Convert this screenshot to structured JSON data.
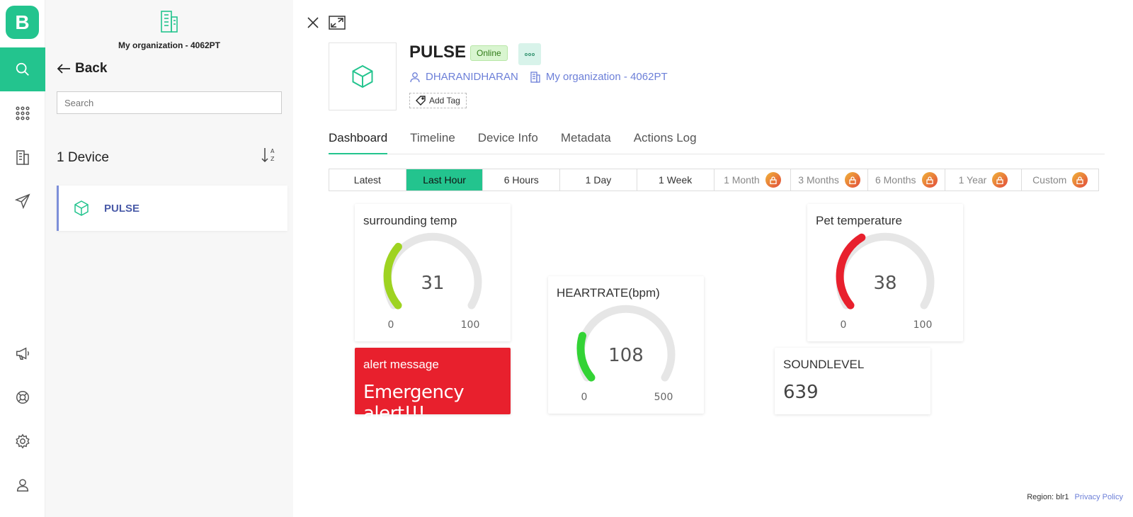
{
  "rail": {
    "logo": "B",
    "items": [
      "search-icon",
      "apps-icon",
      "building-icon",
      "send-icon",
      "megaphone-icon",
      "lifebuoy-icon",
      "gear-icon",
      "user-icon"
    ]
  },
  "sidebar": {
    "org_name": "My organization - 4062PT",
    "back_label": "Back",
    "search_placeholder": "Search",
    "device_count": "1 Device",
    "devices": [
      {
        "name": "PULSE"
      }
    ]
  },
  "device": {
    "name": "PULSE",
    "status": "Online",
    "owner": "DHARANIDHARAN",
    "organization": "My organization - 4062PT",
    "add_tag": "Add Tag"
  },
  "tabs": [
    "Dashboard",
    "Timeline",
    "Device Info",
    "Metadata",
    "Actions Log"
  ],
  "active_tab": "Dashboard",
  "time_ranges": [
    {
      "label": "Latest",
      "locked": false
    },
    {
      "label": "Last Hour",
      "locked": false,
      "active": true
    },
    {
      "label": "6 Hours",
      "locked": false
    },
    {
      "label": "1 Day",
      "locked": false
    },
    {
      "label": "1 Week",
      "locked": false
    },
    {
      "label": "1 Month",
      "locked": true
    },
    {
      "label": "3 Months",
      "locked": true
    },
    {
      "label": "6 Months",
      "locked": true
    },
    {
      "label": "1 Year",
      "locked": true
    },
    {
      "label": "Custom",
      "locked": true
    }
  ],
  "widgets": {
    "surrounding_temp": {
      "title": "surrounding temp",
      "value": 31,
      "min": "0",
      "max": "100",
      "color": "#9ed321"
    },
    "heartrate": {
      "title": "HEARTRATE(bpm)",
      "value": 108,
      "min": "0",
      "max": "500",
      "color": "#33d335"
    },
    "pet_temperature": {
      "title": "Pet temperature",
      "value": 38,
      "min": "0",
      "max": "100",
      "color": "#e8202d"
    },
    "alert": {
      "title": "alert message",
      "message": "Emergency alert!!!"
    },
    "soundlevel": {
      "title": "SOUNDLEVEL",
      "value": "639"
    }
  },
  "footer": {
    "region": "Region: blr1",
    "privacy": "Privacy Policy"
  },
  "colors": {
    "accent": "#23c48e",
    "link": "#6c7fd8",
    "alert": "#e8202d"
  }
}
